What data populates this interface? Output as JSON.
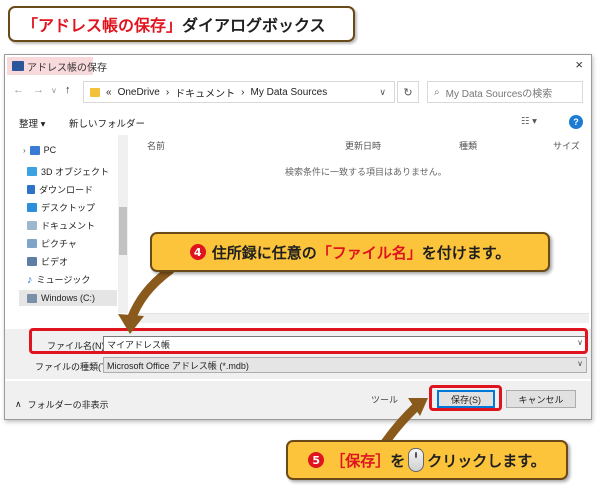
{
  "banner": {
    "red_part": "「アドレス帳の保存」",
    "rest": "ダイアログボックス"
  },
  "dialog": {
    "title": "アドレス帳の保存",
    "close_glyph": "×",
    "breadcrumb": {
      "sep": "«",
      "items": [
        "OneDrive",
        "ドキュメント",
        "My Data Sources"
      ]
    },
    "search_placeholder": "My Data Sourcesの検索",
    "toolbar": {
      "organize": "整理 ▾",
      "new_folder": "新しいフォルダー",
      "help": "?"
    },
    "nav_items": [
      "PC",
      "3D オブジェクト",
      "ダウンロード",
      "デスクトップ",
      "ドキュメント",
      "ピクチャ",
      "ビデオ",
      "ミュージック",
      "Windows (C:)"
    ],
    "columns": [
      "名前",
      "更新日時",
      "種類",
      "サイズ"
    ],
    "empty_message": "検索条件に一致する項目はありません。",
    "filename_label": "ファイル名(N):",
    "filename_value": "マイアドレス帳",
    "filetype_label": "ファイルの種類(T):",
    "filetype_value": "Microsoft Office アドレス帳 (*.mdb)",
    "hide_folders": "フォルダーの非表示",
    "tools": "ツール",
    "save_button": "保存(S)",
    "cancel_button": "キャンセル"
  },
  "callout4": {
    "num": "4",
    "text_before": "住所録に任意の",
    "red_part": "「ファイル名」",
    "text_after": "を付けます。"
  },
  "callout5": {
    "num": "5",
    "red_part": "［保存］",
    "text_mid": "を",
    "text_after": "クリックします。"
  },
  "colors": {
    "accent_red": "#e0141e",
    "callout_fill": "#fbc43b",
    "callout_border": "#6b4a1a",
    "brown_arrow": "#8a5a1c"
  }
}
